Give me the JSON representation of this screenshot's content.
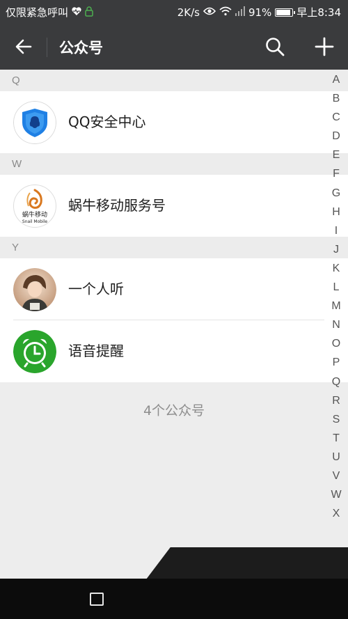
{
  "status_bar": {
    "left_text": "仅限紧急呼叫",
    "left_icons": [
      "heart-icon",
      "lock-icon"
    ],
    "speed": "2K/s",
    "battery_percent": "91%",
    "battery_level": 0.91,
    "time": "早上8:34",
    "right_icons": [
      "eye-icon",
      "wifi-icon",
      "signal-icon",
      "battery-icon"
    ]
  },
  "header": {
    "title": "公众号",
    "back_icon": "arrow-left-icon",
    "search_icon": "search-icon",
    "add_icon": "plus-icon"
  },
  "sections": [
    {
      "letter": "Q",
      "items": [
        {
          "name": "QQ安全中心",
          "avatar": "qq-shield-icon"
        }
      ]
    },
    {
      "letter": "W",
      "items": [
        {
          "name": "蜗牛移动服务号",
          "avatar": "snail-logo",
          "logo_text": "蜗牛移动",
          "logo_subtext": "Snail Mobile"
        }
      ]
    },
    {
      "letter": "Y",
      "items": [
        {
          "name": "一个人听",
          "avatar": "person-photo"
        },
        {
          "name": "语音提醒",
          "avatar": "alarm-clock-icon"
        }
      ]
    }
  ],
  "footer_count": "4个公众号",
  "index_letters": [
    "A",
    "B",
    "C",
    "D",
    "E",
    "F",
    "G",
    "H",
    "I",
    "J",
    "K",
    "L",
    "M",
    "N",
    "O",
    "P",
    "Q",
    "R",
    "S",
    "T",
    "U",
    "V",
    "W",
    "X"
  ],
  "colors": {
    "header_bg": "#3a3b3d",
    "list_bg": "#ffffff",
    "page_bg": "#ededed",
    "accent_green": "#1aad19"
  }
}
